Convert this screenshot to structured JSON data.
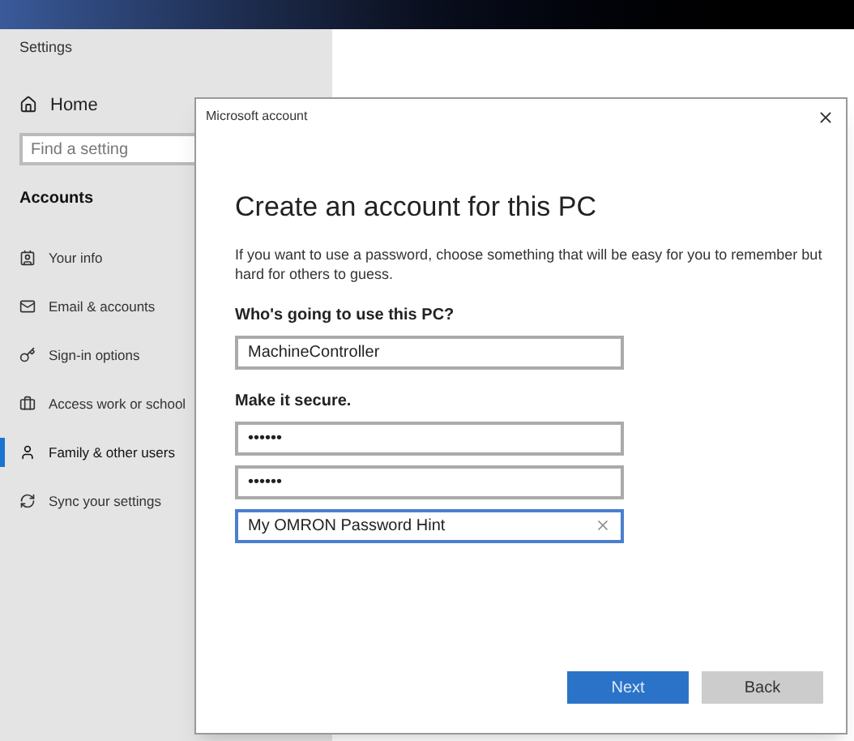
{
  "settings": {
    "title": "Settings",
    "home": "Home",
    "search": {
      "placeholder": "Find a setting"
    },
    "section": "Accounts",
    "items": [
      {
        "label": "Your info",
        "selected": false
      },
      {
        "label": "Email & accounts",
        "selected": false
      },
      {
        "label": "Sign-in options",
        "selected": false
      },
      {
        "label": "Access work or school",
        "selected": false
      },
      {
        "label": "Family & other users",
        "selected": true
      },
      {
        "label": "Sync your settings",
        "selected": false
      }
    ]
  },
  "dialog": {
    "title": "Microsoft account",
    "heading": "Create an account for this PC",
    "description": "If you want to use a password, choose something that will be easy for you to remember but hard for others to guess.",
    "sections": [
      {
        "label": "Who's going to use this PC?",
        "fields": [
          {
            "value": "MachineController",
            "focused": false
          }
        ]
      },
      {
        "label": "Make it secure.",
        "fields": [
          {
            "value": "••••••",
            "focused": false
          },
          {
            "value": "••••••",
            "focused": false
          },
          {
            "value": "My OMRON Password Hint",
            "focused": true
          }
        ]
      }
    ],
    "buttons": [
      {
        "label": "Next",
        "primary": true
      },
      {
        "label": "Back",
        "primary": false
      }
    ]
  }
}
